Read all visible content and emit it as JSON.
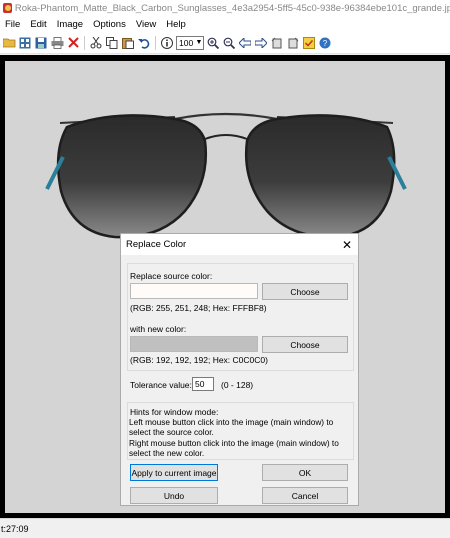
{
  "window": {
    "title": "Roka-Phantom_Matte_Black_Carbon_Sunglasses_4e3a2954-5ff5-45c0-938e-96384ebe101c_grande.jpg - IrfanView"
  },
  "menu": [
    "File",
    "Edit",
    "Image",
    "Options",
    "View",
    "Help"
  ],
  "toolbar": {
    "zoom_value": "100",
    "icons": [
      "open-folder-icon",
      "thumbnails-icon",
      "save-icon",
      "print-icon",
      "delete-icon",
      "cut-icon",
      "copy-icon",
      "paste-icon",
      "undo-icon",
      "info-icon",
      "zoom-in-icon",
      "zoom-out-icon",
      "previous-icon",
      "next-icon",
      "rotate-left-icon",
      "rotate-right-icon",
      "settings-icon",
      "help-icon"
    ]
  },
  "status": {
    "text": "t:27:09"
  },
  "dialog": {
    "title": "Replace Color",
    "source_label": "Replace source color:",
    "source_color": "#FFFBF8",
    "source_info": "(RGB: 255, 251, 248; Hex: FFFBF8)",
    "choose_label": "Choose",
    "new_label": "with new color:",
    "new_color": "#C0C0C0",
    "new_info": "(RGB: 192, 192, 192; Hex: C0C0C0)",
    "tolerance_label": "Tolerance value:",
    "tolerance_value": "50",
    "tolerance_range": "(0 - 128)",
    "hints_title": "Hints for window mode:",
    "hint_left": "Left mouse button click into the image (main window) to select the source color.",
    "hint_right": "Right mouse button click into the image (main window) to select the new color.",
    "apply_label": "Apply to current image",
    "ok_label": "OK",
    "undo_label": "Undo",
    "cancel_label": "Cancel"
  },
  "colors": {
    "viewer_bg": "#000000",
    "image_bg": "#d4d4d4",
    "accent": "#0078d7"
  }
}
